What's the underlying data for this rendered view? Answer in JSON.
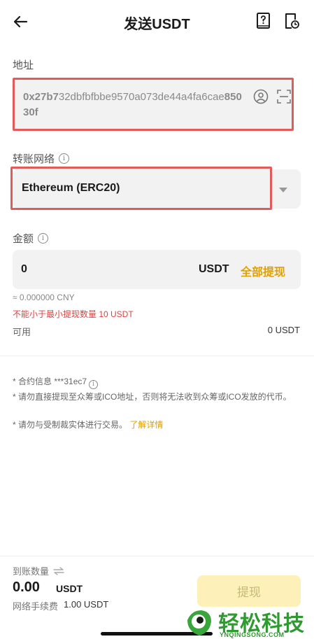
{
  "header": {
    "title": "发送USDT",
    "back_icon": "arrow-left-icon",
    "help_icon": "help-book-icon",
    "history_icon": "history-doc-icon"
  },
  "address": {
    "label": "地址",
    "value_start": "0x27b7",
    "value_middle": "32dbfbfbbe9570a073de44a4fa6cae",
    "value_end": "85030f"
  },
  "network": {
    "label": "转账网络",
    "selected": "Ethereum (ERC20)"
  },
  "amount": {
    "label": "金额",
    "value": "0",
    "unit": "USDT",
    "all_label": "全部提现",
    "approx": "≈ 0.000000 CNY",
    "error": "不能小于最小提现数量 10 USDT",
    "available_label": "可用",
    "available_value": "0 USDT"
  },
  "notes": {
    "contract": "* 合约信息 ***31ec7",
    "ico": "* 请勿直接提现至众筹或ICO地址，否则将无法收到众筹或ICO发放的代币。",
    "sanction": "* 请勿与受制裁实体进行交易。",
    "details_link": "了解详情"
  },
  "footer": {
    "receive_label": "到账数量",
    "receive_value": "0.00",
    "receive_unit": "USDT",
    "fee_label": "网络手续费",
    "fee_value": "1.00 USDT",
    "submit_label": "提现"
  },
  "watermark": {
    "text": "轻松科技",
    "sub": "YNQINGSONG.COM"
  },
  "colors": {
    "accent": "#e0a000",
    "highlight_border": "#e25a5a",
    "error": "#e0413c",
    "brand_green": "#2f9a2f"
  }
}
